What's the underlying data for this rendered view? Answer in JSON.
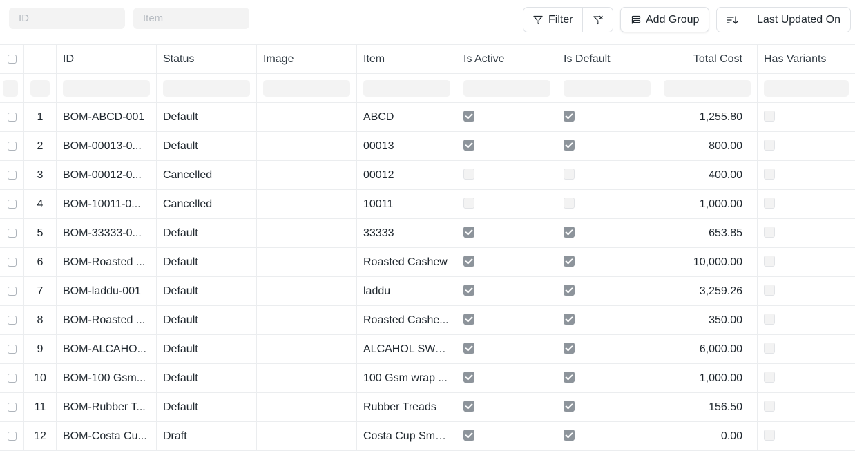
{
  "toolbar": {
    "search_id_placeholder": "ID",
    "search_item_placeholder": "Item",
    "filter_label": "Filter",
    "add_group_label": "Add Group",
    "sort_label": "Last Updated On"
  },
  "columns": {
    "id": "ID",
    "status": "Status",
    "image": "Image",
    "item": "Item",
    "is_active": "Is Active",
    "is_default": "Is Default",
    "total_cost": "Total Cost",
    "has_variants": "Has Variants"
  },
  "rows": [
    {
      "no": "1",
      "id": "BOM-ABCD-001",
      "status": "Default",
      "item": "ABCD",
      "is_active": true,
      "is_default": true,
      "total_cost": "1,255.80",
      "has_variants": false
    },
    {
      "no": "2",
      "id": "BOM-00013-0...",
      "status": "Default",
      "item": "00013",
      "is_active": true,
      "is_default": true,
      "total_cost": "800.00",
      "has_variants": false
    },
    {
      "no": "3",
      "id": "BOM-00012-0...",
      "status": "Cancelled",
      "item": "00012",
      "is_active": false,
      "is_default": false,
      "total_cost": "400.00",
      "has_variants": false
    },
    {
      "no": "4",
      "id": "BOM-10011-0...",
      "status": "Cancelled",
      "item": "10011",
      "is_active": false,
      "is_default": false,
      "total_cost": "1,000.00",
      "has_variants": false
    },
    {
      "no": "5",
      "id": "BOM-33333-0...",
      "status": "Default",
      "item": "33333",
      "is_active": true,
      "is_default": true,
      "total_cost": "653.85",
      "has_variants": false
    },
    {
      "no": "6",
      "id": "BOM-Roasted ...",
      "status": "Default",
      "item": "Roasted Cashew",
      "is_active": true,
      "is_default": true,
      "total_cost": "10,000.00",
      "has_variants": false
    },
    {
      "no": "7",
      "id": "BOM-laddu-001",
      "status": "Default",
      "item": "laddu",
      "is_active": true,
      "is_default": true,
      "total_cost": "3,259.26",
      "has_variants": false
    },
    {
      "no": "8",
      "id": "BOM-Roasted ...",
      "status": "Default",
      "item": "Roasted Cashe...",
      "is_active": true,
      "is_default": true,
      "total_cost": "350.00",
      "has_variants": false
    },
    {
      "no": "9",
      "id": "BOM-ALCAHO...",
      "status": "Default",
      "item": "ALCAHOL SWA...",
      "is_active": true,
      "is_default": true,
      "total_cost": "6,000.00",
      "has_variants": false
    },
    {
      "no": "10",
      "id": "BOM-100 Gsm...",
      "status": "Default",
      "item": "100 Gsm wrap ...",
      "is_active": true,
      "is_default": true,
      "total_cost": "1,000.00",
      "has_variants": false
    },
    {
      "no": "11",
      "id": "BOM-Rubber T...",
      "status": "Default",
      "item": "Rubber Treads",
      "is_active": true,
      "is_default": true,
      "total_cost": "156.50",
      "has_variants": false
    },
    {
      "no": "12",
      "id": "BOM-Costa Cu...",
      "status": "Draft",
      "item": "Costa Cup Sma...",
      "is_active": true,
      "is_default": true,
      "total_cost": "0.00",
      "has_variants": false
    }
  ]
}
